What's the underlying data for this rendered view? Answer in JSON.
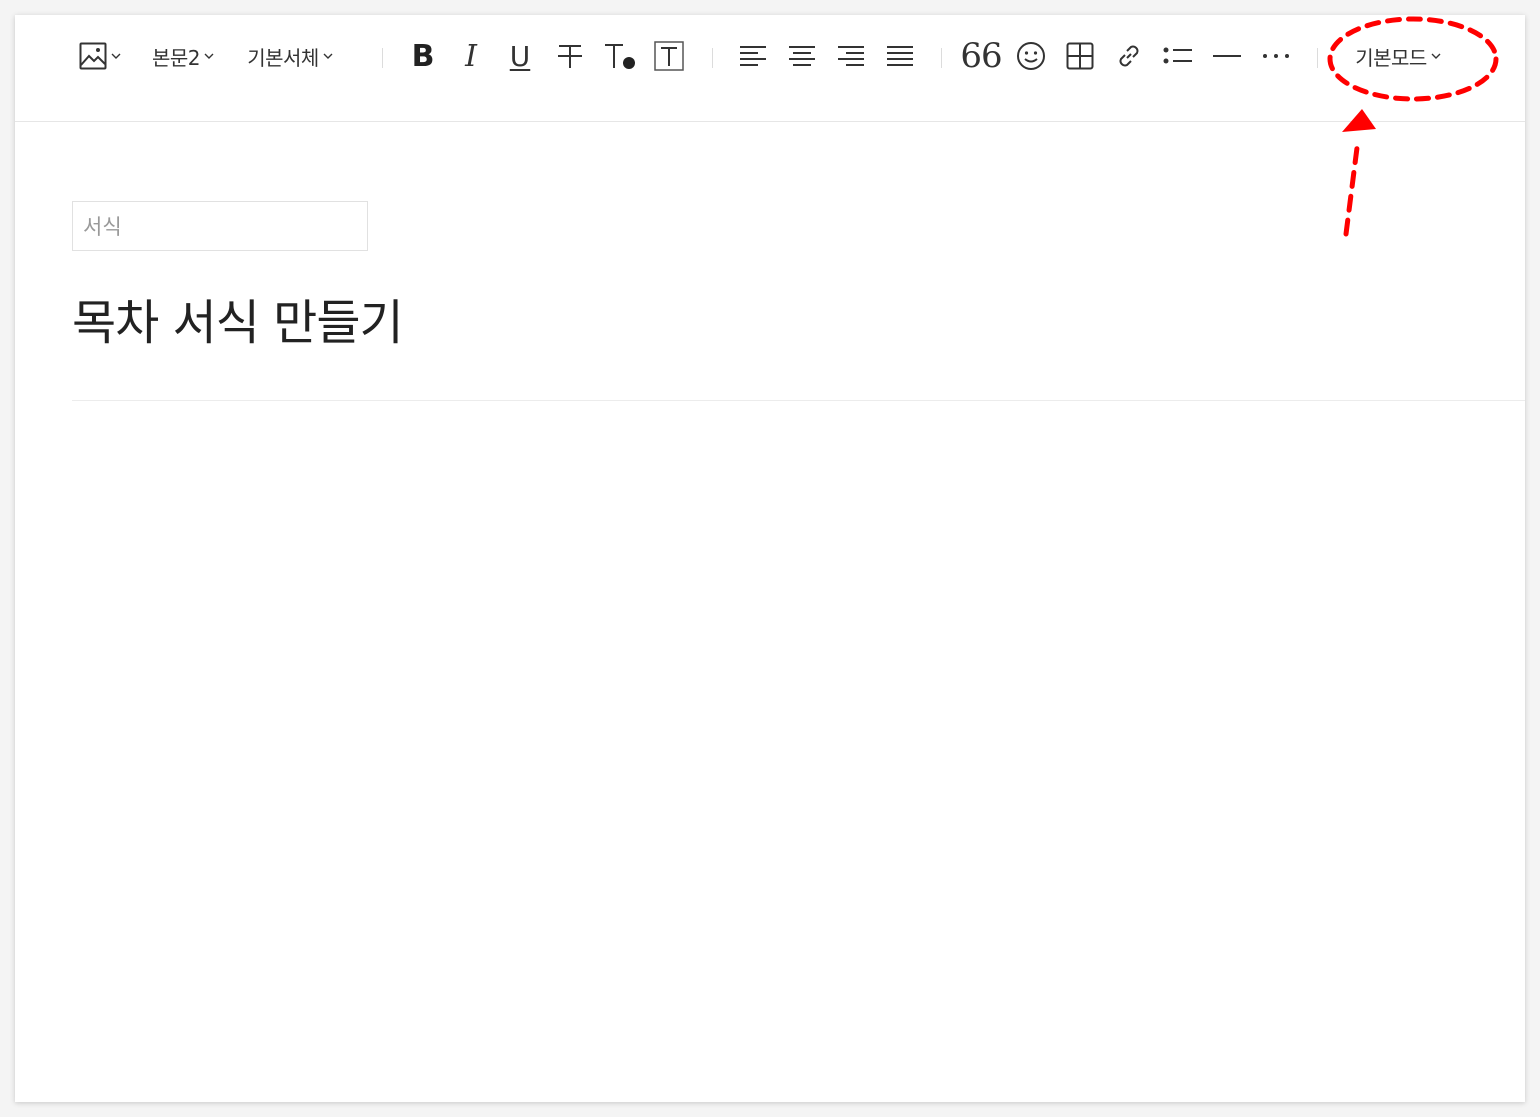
{
  "toolbar": {
    "image_icon": "image-icon",
    "paragraph_style": "본문2",
    "font_family": "기본서체",
    "bold": "B",
    "italic": "I",
    "underline": "U",
    "strikethrough_icon": "strikethrough-icon",
    "text_color_icon": "text-color-icon",
    "text_bg_icon": "text-background-icon",
    "align_left_icon": "align-left-icon",
    "align_center_icon": "align-center-icon",
    "align_right_icon": "align-right-icon",
    "align_justify_icon": "align-justify-icon",
    "quote": "66",
    "emoji_icon": "emoji-icon",
    "table_icon": "table-icon",
    "link_icon": "link-icon",
    "list_icon": "list-icon",
    "hr_icon": "horizontal-rule-icon",
    "more_icon": "more-icon",
    "mode": "기본모드"
  },
  "editor": {
    "format_placeholder": "서식",
    "title": "목차 서식 만들기"
  },
  "colors": {
    "annotation": "#ff0000",
    "text": "#333333"
  }
}
